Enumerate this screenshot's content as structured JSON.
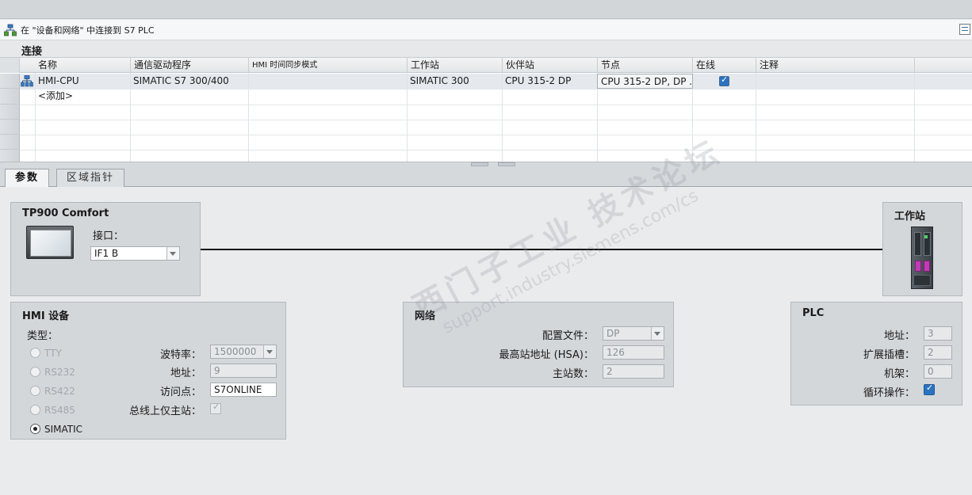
{
  "title_bar": {
    "text": "在 \"设备和网络\" 中连接到 S7 PLC"
  },
  "section_title": "连接",
  "table": {
    "columns": [
      "名称",
      "通信驱动程序",
      "HMI 时间同步模式",
      "工作站",
      "伙伴站",
      "节点",
      "在线",
      "注释"
    ],
    "rows": [
      {
        "name": "HMI-CPU",
        "driver": "SIMATIC S7 300/400",
        "time_sync": "",
        "station": "SIMATIC 300",
        "partner": "CPU 315-2 DP",
        "node": "CPU 315-2 DP, DP ...",
        "online": true,
        "comment": ""
      }
    ],
    "add_row": "<添加>"
  },
  "tabs": [
    {
      "label": "参数",
      "active": true
    },
    {
      "label": "区域指针",
      "active": false
    }
  ],
  "hmi_panel": {
    "title": "TP900 Comfort",
    "interface_label": "接口：",
    "interface_value": "IF1 B"
  },
  "station_panel": {
    "title": "工作站"
  },
  "hmi_device": {
    "title": "HMI 设备",
    "type_label": "类型：",
    "types": [
      "TTY",
      "RS232",
      "RS422",
      "RS485",
      "SIMATIC"
    ],
    "selected_type": "SIMATIC",
    "baud_label": "波特率：",
    "baud_value": "1500000",
    "address_label": "地址：",
    "address_value": "9",
    "access_label": "访问点：",
    "access_value": "S7ONLINE",
    "master_label": "总线上仅主站："
  },
  "network": {
    "title": "网络",
    "profile_label": "配置文件：",
    "profile_value": "DP",
    "hsa_label": "最高站地址 (HSA)：",
    "hsa_value": "126",
    "masters_label": "主站数：",
    "masters_value": "2"
  },
  "plc": {
    "title": "PLC",
    "address_label": "地址：",
    "address_value": "3",
    "slot_label": "扩展插槽：",
    "slot_value": "2",
    "rack_label": "机架：",
    "rack_value": "0",
    "cyclic_label": "循环操作：",
    "cyclic_checked": true
  },
  "watermark": {
    "line1": "西门子工业 技术论坛",
    "line2": "support.industry.siemens.com/cs"
  },
  "icons": {
    "network": "network-connection-icon",
    "station_row": "station-node-icon",
    "hmi_device": "hmi-panel-image",
    "plc_device": "plc-station-image"
  }
}
